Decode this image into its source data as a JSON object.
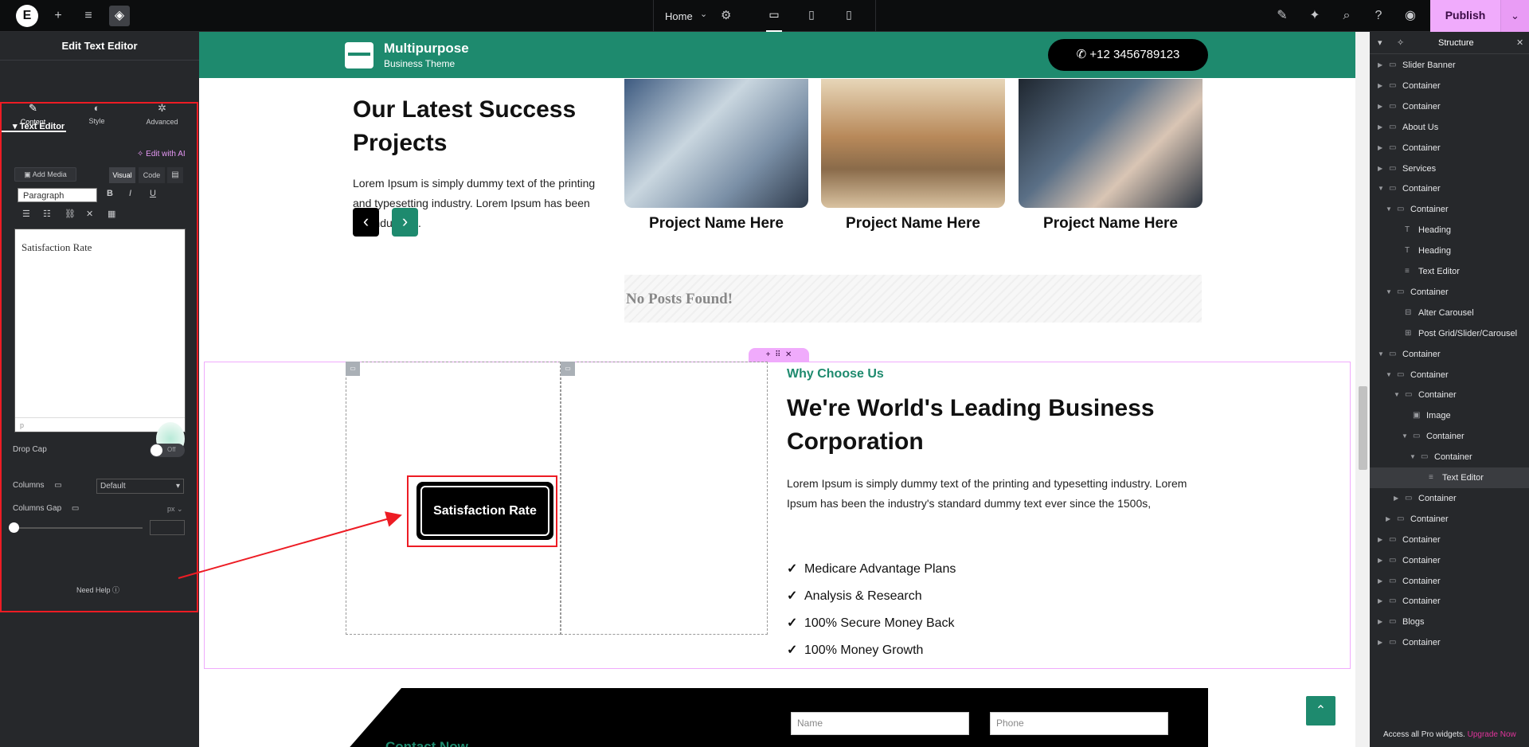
{
  "topbar": {
    "logo": "E",
    "add_icon": "+",
    "settings_icon": "≡",
    "layers_icon": "◈",
    "page_name": "Home",
    "publish": "Publish"
  },
  "left_panel": {
    "title": "Edit Text Editor",
    "tabs": [
      {
        "label": "Content",
        "icon": "✎"
      },
      {
        "label": "Style",
        "icon": "◐"
      },
      {
        "label": "Advanced",
        "icon": "✲"
      }
    ],
    "section": "Text Editor",
    "edit_ai": "Edit with AI",
    "add_media": "Add Media",
    "visual": "Visual",
    "code": "Code",
    "paragraph": "Paragraph",
    "editor_text": "Satisfaction Rate",
    "editor_footer": "p",
    "drop_cap": "Drop Cap",
    "toggle_off": "Off",
    "columns": "Columns",
    "columns_value": "Default",
    "columns_gap": "Columns Gap",
    "unit": "px",
    "need_help": "Need Help"
  },
  "site": {
    "brand_name": "Multipurpose",
    "brand_sub": "Business Theme",
    "phone": "+12 3456789123",
    "projects_title": "Our Latest Success Projects",
    "projects_desc": "Lorem Ipsum is simply dummy text of the printing and typesetting industry. Lorem Ipsum has been the industry's.",
    "prev": "‹",
    "next": "›",
    "cards": [
      {
        "name": "Project Name Here"
      },
      {
        "name": "Project Name Here"
      },
      {
        "name": "Project Name Here"
      }
    ],
    "no_posts": "No Posts Found!",
    "satisfaction": "Satisfaction Rate",
    "why": "Why Choose Us",
    "lead_title": "We're World's Leading Business Corporation",
    "lead_desc": "Lorem Ipsum is simply dummy text of the printing and typesetting industry. Lorem Ipsum has been the industry's standard dummy text ever since the 1500s,",
    "bullets": [
      "Medicare Advantage Plans",
      "Analysis & Research",
      "100% Secure Money Back",
      "100% Money Growth"
    ],
    "contact_now": "Contact Now",
    "name_placeholder": "Name",
    "phone_placeholder": "Phone",
    "to_top": "⌃"
  },
  "structure": {
    "title": "Structure",
    "items": [
      {
        "label": "Slider Banner",
        "depth": 0,
        "caret": "▶",
        "icon": "▭"
      },
      {
        "label": "Container",
        "depth": 0,
        "caret": "▶",
        "icon": "▭"
      },
      {
        "label": "Container",
        "depth": 0,
        "caret": "▶",
        "icon": "▭"
      },
      {
        "label": "About Us",
        "depth": 0,
        "caret": "▶",
        "icon": "▭"
      },
      {
        "label": "Container",
        "depth": 0,
        "caret": "▶",
        "icon": "▭"
      },
      {
        "label": "Services",
        "depth": 0,
        "caret": "▶",
        "icon": "▭"
      },
      {
        "label": "Container",
        "depth": 0,
        "caret": "▼",
        "icon": "▭"
      },
      {
        "label": "Container",
        "depth": 1,
        "caret": "▼",
        "icon": "▭"
      },
      {
        "label": "Heading",
        "depth": 2,
        "caret": "",
        "icon": "T"
      },
      {
        "label": "Heading",
        "depth": 2,
        "caret": "",
        "icon": "T"
      },
      {
        "label": "Text Editor",
        "depth": 2,
        "caret": "",
        "icon": "≡"
      },
      {
        "label": "Container",
        "depth": 1,
        "caret": "▼",
        "icon": "▭"
      },
      {
        "label": "Alter Carousel",
        "depth": 2,
        "caret": "",
        "icon": "⊟"
      },
      {
        "label": "Post Grid/Slider/Carousel",
        "depth": 2,
        "caret": "",
        "icon": "⊞"
      },
      {
        "label": "Container",
        "depth": 0,
        "caret": "▼",
        "icon": "▭"
      },
      {
        "label": "Container",
        "depth": 1,
        "caret": "▼",
        "icon": "▭"
      },
      {
        "label": "Container",
        "depth": 2,
        "caret": "▼",
        "icon": "▭"
      },
      {
        "label": "Image",
        "depth": 3,
        "caret": "",
        "icon": "▣"
      },
      {
        "label": "Container",
        "depth": 3,
        "caret": "▼",
        "icon": "▭"
      },
      {
        "label": "Container",
        "depth": 4,
        "caret": "▼",
        "icon": "▭"
      },
      {
        "label": "Text Editor",
        "depth": 5,
        "caret": "",
        "icon": "≡"
      },
      {
        "label": "Container",
        "depth": 2,
        "caret": "▶",
        "icon": "▭"
      },
      {
        "label": "Container",
        "depth": 1,
        "caret": "▶",
        "icon": "▭"
      },
      {
        "label": "Container",
        "depth": 0,
        "caret": "▶",
        "icon": "▭"
      },
      {
        "label": "Container",
        "depth": 0,
        "caret": "▶",
        "icon": "▭"
      },
      {
        "label": "Container",
        "depth": 0,
        "caret": "▶",
        "icon": "▭"
      },
      {
        "label": "Container",
        "depth": 0,
        "caret": "▶",
        "icon": "▭"
      },
      {
        "label": "Blogs",
        "depth": 0,
        "caret": "▶",
        "icon": "▭"
      },
      {
        "label": "Container",
        "depth": 0,
        "caret": "▶",
        "icon": "▭"
      }
    ],
    "selected_index": 20,
    "promo_text": "Access all Pro widgets.",
    "promo_link": "Upgrade Now"
  }
}
